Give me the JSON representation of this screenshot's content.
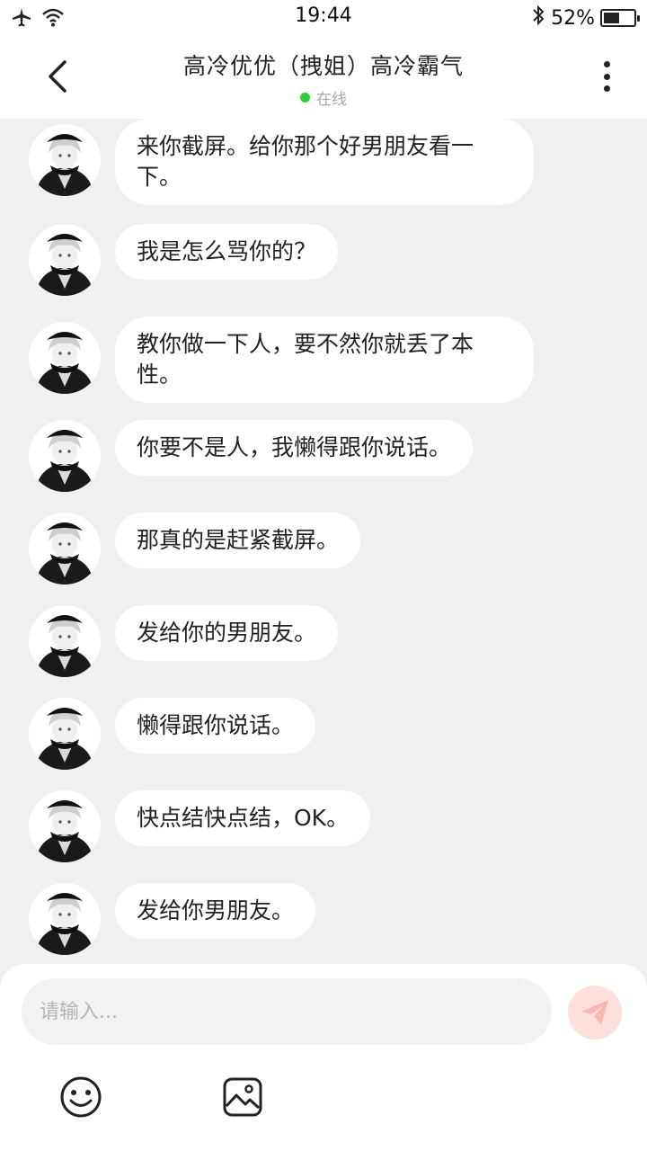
{
  "status_bar": {
    "time": "19:44",
    "battery_text": "52%",
    "battery_level": 0.52,
    "icons": [
      "airplane-icon",
      "wifi-icon",
      "bluetooth-icon",
      "battery-icon"
    ]
  },
  "header": {
    "title": "高冷优优（拽姐）高冷霸气",
    "status": "在线",
    "status_color": "#2ecc40"
  },
  "messages": [
    {
      "text": "来你截屏。给你那个好男朋友看一下。"
    },
    {
      "text": "我是怎么骂你的？"
    },
    {
      "text": "教你做一下人，要不然你就丢了本性。"
    },
    {
      "text": "你要不是人，我懒得跟你说话。"
    },
    {
      "text": "那真的是赶紧截屏。"
    },
    {
      "text": "发给你的男朋友。"
    },
    {
      "text": "懒得跟你说话。"
    },
    {
      "text": "快点结快点结，OK。"
    },
    {
      "text": "发给你男朋友。"
    }
  ],
  "composer": {
    "placeholder": "请输入...",
    "icons": [
      "send-icon",
      "emoji-icon",
      "image-icon"
    ]
  },
  "colors": {
    "background": "#f0f0f2",
    "bubble": "#ffffff",
    "send_button": "#fde0dc",
    "send_icon": "#f6b8b0"
  }
}
